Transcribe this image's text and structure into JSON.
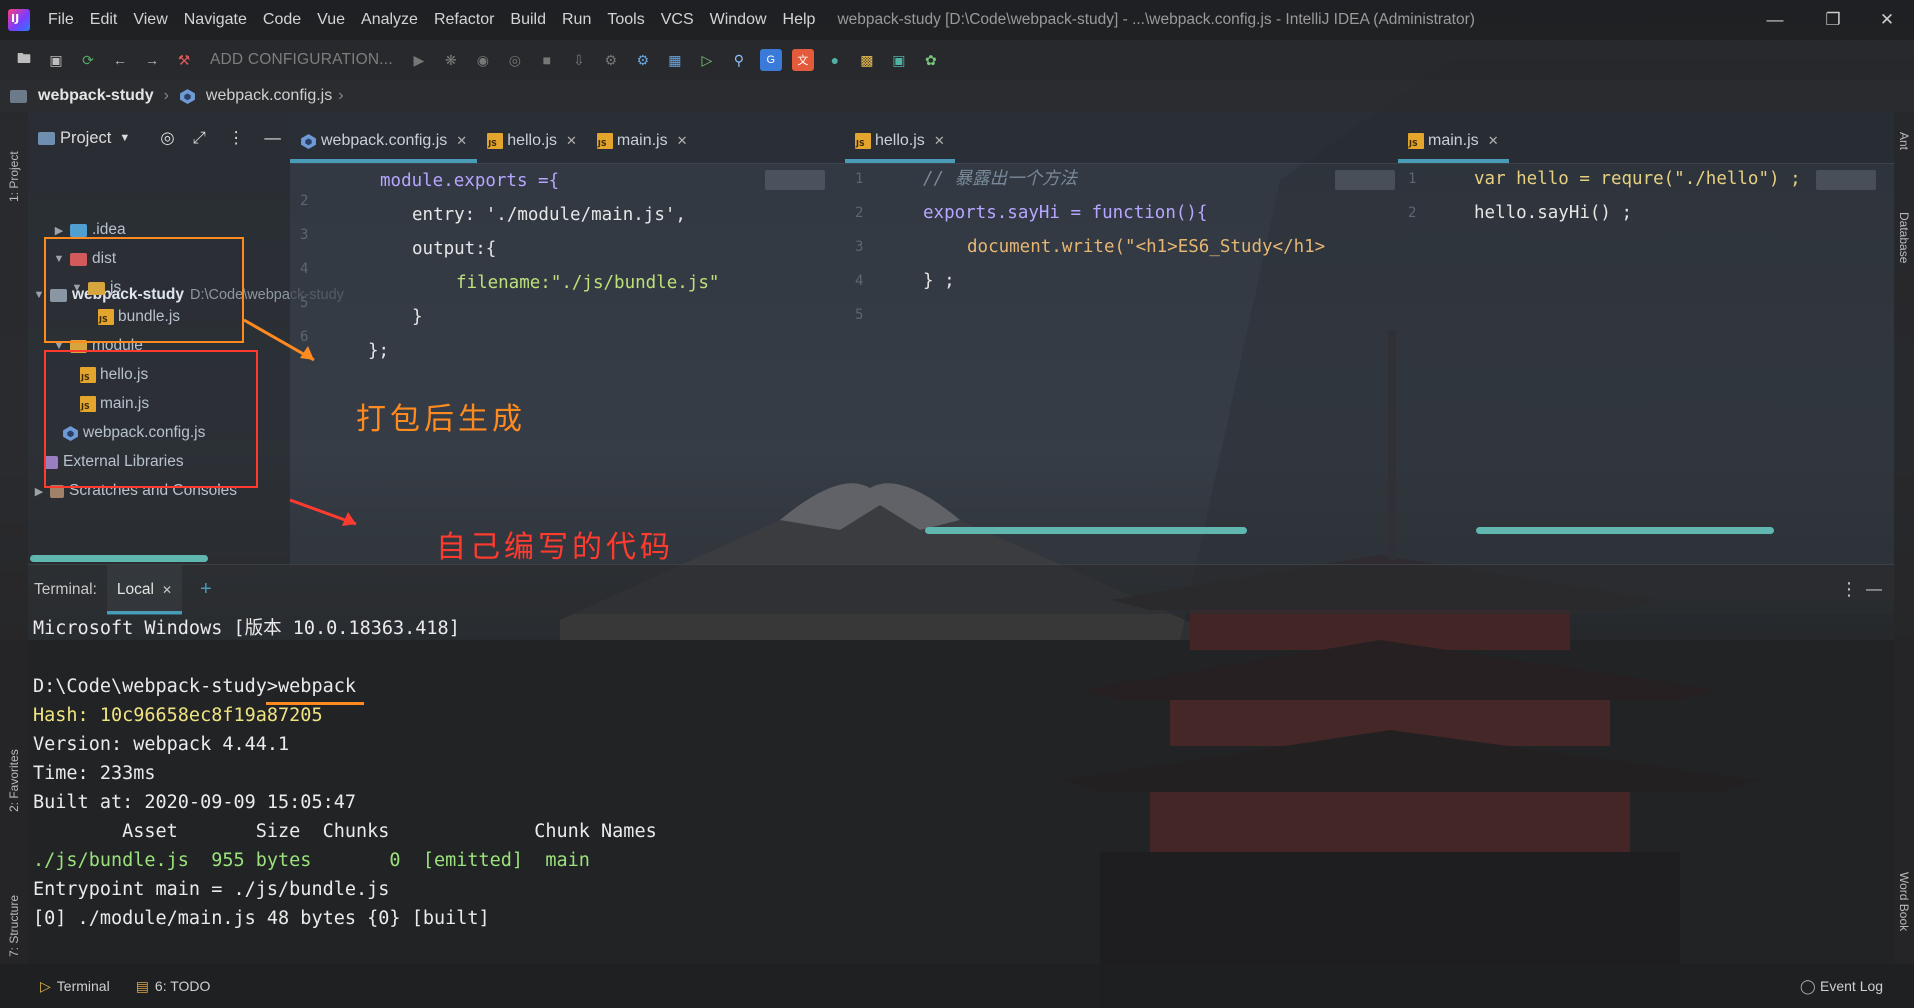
{
  "titlebar": {
    "menu": [
      "File",
      "Edit",
      "View",
      "Navigate",
      "Code",
      "Vue",
      "Analyze",
      "Refactor",
      "Build",
      "Run",
      "Tools",
      "VCS",
      "Window",
      "Help"
    ],
    "title": "webpack-study [D:\\Code\\webpack-study] - ...\\webpack.config.js - IntelliJ IDEA (Administrator)"
  },
  "toolbar": {
    "run_config": "ADD CONFIGURATION..."
  },
  "breadcrumb": {
    "project": "webpack-study",
    "file": "webpack.config.js"
  },
  "side_tabs": {
    "project": "1: Project",
    "favorites": "2: Favorites",
    "structure": "7: Structure",
    "ant": "Ant",
    "database": "Database",
    "word_book": "Word Book"
  },
  "project_panel": {
    "title": "Project",
    "tree": {
      "root": "webpack-study",
      "root_path": "D:\\Code\\webpack-study",
      "idea": ".idea",
      "dist": "dist",
      "js": "js",
      "bundle": "bundle.js",
      "module": "module",
      "hello": "hello.js",
      "main": "main.js",
      "config": "webpack.config.js",
      "ext_libs": "External Libraries",
      "scratches": "Scratches and Consoles"
    }
  },
  "annotations": {
    "generated": "打包后生成",
    "own_code": "自己编写的代码"
  },
  "editors": {
    "config": {
      "tabs": [
        "webpack.config.js",
        "hello.js",
        "main.js"
      ],
      "lines": [
        "module.exports ={",
        "entry: './module/main.js',",
        "output:{",
        "filename:\"./js/bundle.js\"",
        "}",
        "};"
      ]
    },
    "hello": {
      "tab": "hello.js",
      "comment": "// 暴露出一个方法",
      "lines": [
        "exports.sayHi = function(){",
        "document.write(\"<h1>ES6_Study</h1>",
        "} ;"
      ]
    },
    "main": {
      "tab": "main.js",
      "lines": [
        "var hello = requre(\"./hello\") ;",
        "hello.sayHi() ;"
      ]
    }
  },
  "terminal": {
    "label": "Terminal:",
    "tab": "Local",
    "lines": [
      "Microsoft Windows [版本 10.0.18363.418]",
      "",
      "D:\\Code\\webpack-study>webpack",
      "Hash: 10c96658ec8f19a87205",
      "Version: webpack 4.44.1",
      "Time: 233ms",
      "Built at: 2020-09-09 15:05:47",
      "        Asset       Size  Chunks             Chunk Names",
      "./js/bundle.js  955 bytes       0  [emitted]  main",
      "Entrypoint main = ./js/bundle.js",
      "[0] ./module/main.js 48 bytes {0} [built]"
    ]
  },
  "statusbar": {
    "terminal": "Terminal",
    "todo": "6: TODO",
    "event_log": "Event Log"
  },
  "colors": {
    "accent": "#4a9bb8",
    "annotation_red": "#ff3b2f",
    "annotation_orange": "#ff8a1f",
    "js_badge": "#e3a52c"
  }
}
